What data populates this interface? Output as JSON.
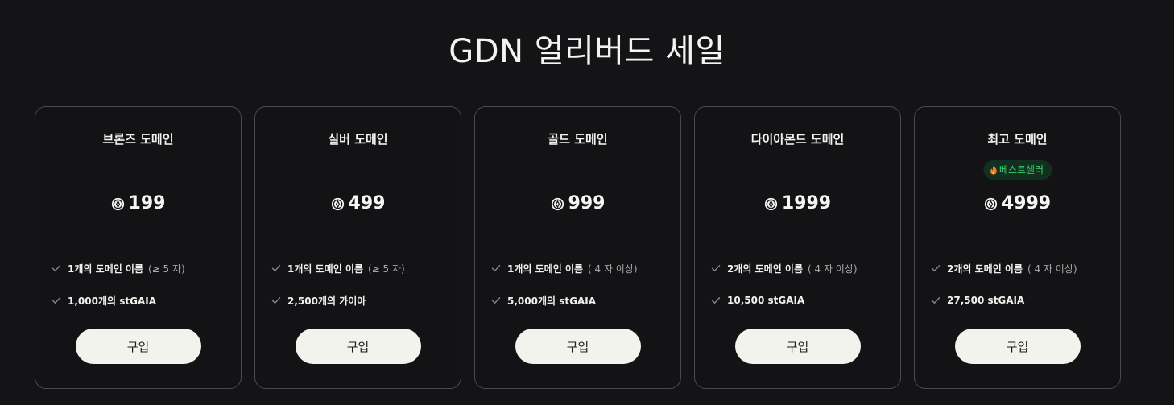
{
  "page": {
    "title": "GDN 얼리버드 세일"
  },
  "colors": {
    "background": "#141416",
    "card_border": "#4a4a4e",
    "badge_bg": "#12301f",
    "badge_text": "#3fcf6e",
    "button_bg": "#f3f3ed"
  },
  "cards": [
    {
      "title": "브론즈 도메인",
      "price": "199",
      "price_icon": "coin-icon",
      "features": [
        {
          "text": "1개의 도메인 이름",
          "note": "(≥ 5 자)"
        },
        {
          "text": "1,000개의 stGAIA",
          "note": ""
        }
      ],
      "button": "구입"
    },
    {
      "title": "실버 도메인",
      "price": "499",
      "price_icon": "coin-icon",
      "features": [
        {
          "text": "1개의 도메인 이름",
          "note": "(≥ 5 자)"
        },
        {
          "text": "2,500개의 가이아",
          "note": ""
        }
      ],
      "button": "구입"
    },
    {
      "title": "골드 도메인",
      "price": "999",
      "price_icon": "coin-icon",
      "features": [
        {
          "text": "1개의 도메인 이름",
          "note": "( 4 자 이상)"
        },
        {
          "text": "5,000개의 stGAIA",
          "note": ""
        }
      ],
      "button": "구입"
    },
    {
      "title": "다이아몬드 도메인",
      "price": "1999",
      "price_icon": "coin-icon",
      "features": [
        {
          "text": "2개의 도메인 이름",
          "note": "( 4 자 이상)"
        },
        {
          "text": "10,500 stGAIA",
          "note": ""
        }
      ],
      "button": "구입"
    },
    {
      "title": "최고 도메인",
      "badge": "베스트셀러",
      "badge_icon": "fire-icon",
      "price": "4999",
      "price_icon": "coin-icon",
      "features": [
        {
          "text": "2개의 도메인 이름",
          "note": "( 4 자 이상)"
        },
        {
          "text": "27,500 stGAIA",
          "note": ""
        }
      ],
      "button": "구입"
    }
  ]
}
